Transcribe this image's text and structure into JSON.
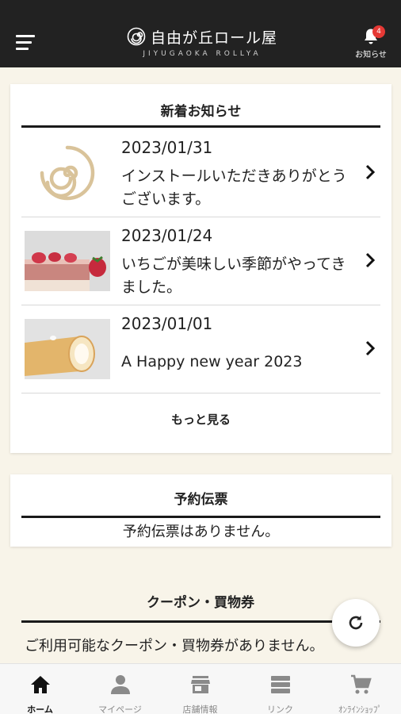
{
  "header": {
    "logo_text": "自由が丘ロール屋",
    "logo_sub": "JIYUGAOKA ROLLYA",
    "notice_label": "お知らせ",
    "notice_badge": "4",
    "accent": "#e53935",
    "bg": "#222222"
  },
  "news": {
    "title": "新着お知らせ",
    "items": [
      {
        "date": "2023/01/31",
        "summary": "インストールいただきありがとうございます。",
        "thumb": "logo-swirl"
      },
      {
        "date": "2023/01/24",
        "summary": "いちごが美味しい季節がやってきました。",
        "thumb": "strawberry-roll-cake"
      },
      {
        "date": "2023/01/01",
        "summary": "A Happy new year 2023",
        "thumb": "roll-cake"
      }
    ],
    "more_label": "もっと見る"
  },
  "reservation": {
    "title": "予約伝票",
    "empty": "予約伝票はありません。"
  },
  "coupon": {
    "title": "クーポン・買物券",
    "empty": "ご利用可能なクーポン・買物券がありません。"
  },
  "tabs": [
    {
      "label": "ホーム",
      "icon": "home-icon",
      "active": true
    },
    {
      "label": "マイページ",
      "icon": "person-icon",
      "active": false
    },
    {
      "label": "店舗情報",
      "icon": "store-icon",
      "active": false
    },
    {
      "label": "リンク",
      "icon": "list-icon",
      "active": false
    },
    {
      "label": "ｵﾝﾗｲﾝｼｮｯﾌﾟ",
      "icon": "cart-icon",
      "active": false
    }
  ],
  "colors": {
    "page_bg": "#f8f4e9",
    "swirl": "#d9c39a"
  }
}
